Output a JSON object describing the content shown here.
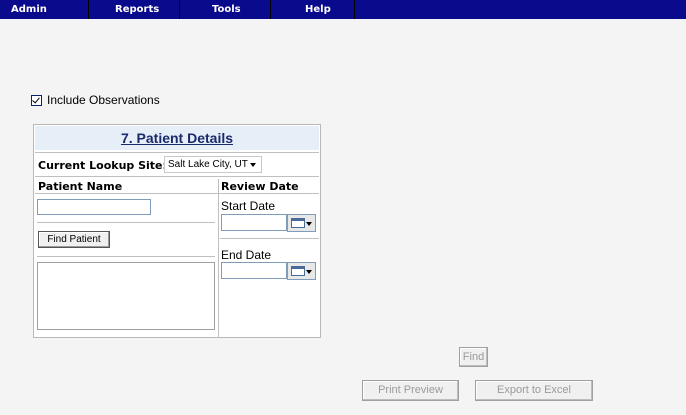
{
  "menu": {
    "items": [
      {
        "label": "Admin"
      },
      {
        "label": "Reports"
      },
      {
        "label": "Tools"
      },
      {
        "label": "Help"
      }
    ]
  },
  "options": {
    "include_observations_label": "Include Observations",
    "include_observations_checked": true
  },
  "panel": {
    "title": "7. Patient Details",
    "lookup_label": "Current Lookup Site:",
    "lookup_value": "Salt Lake City, UT",
    "patient_name_header": "Patient Name",
    "review_date_header": "Review Date",
    "patient_name_value": "",
    "find_patient_label": "Find Patient",
    "start_date_label": "Start Date",
    "start_date_value": "",
    "end_date_label": "End Date",
    "end_date_value": ""
  },
  "actions": {
    "find_label": "Find",
    "print_preview_label": "Print Preview",
    "export_label": "Export to Excel"
  }
}
